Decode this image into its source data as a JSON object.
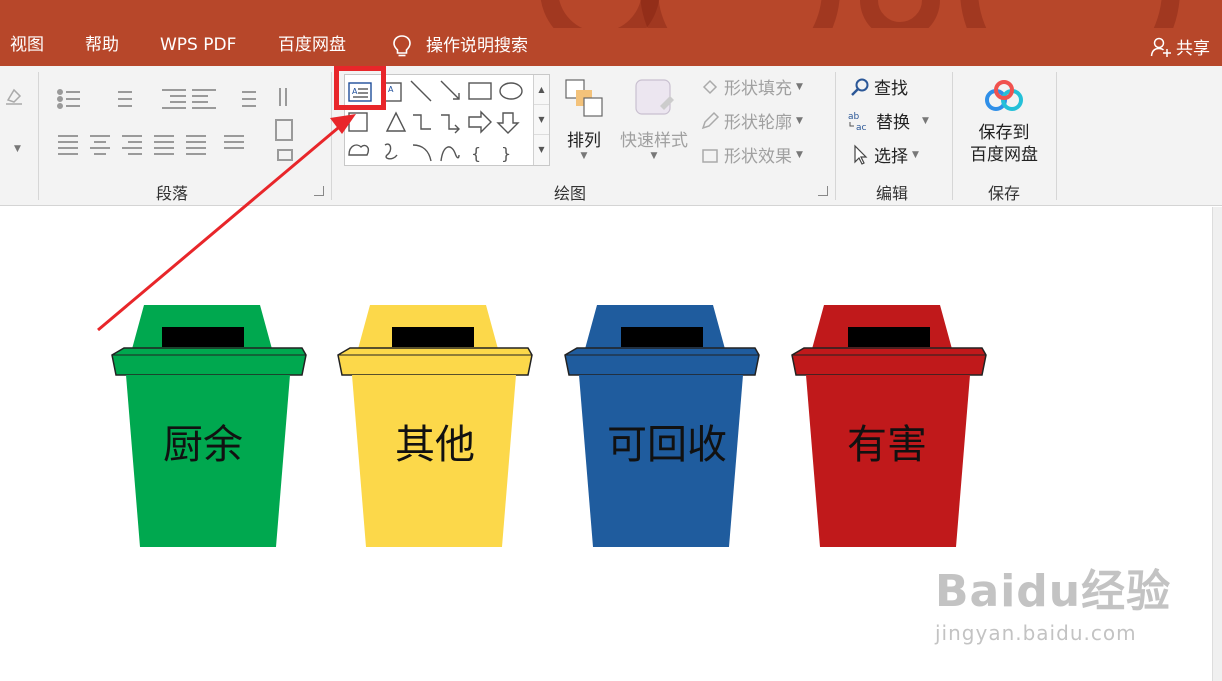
{
  "menubar": {
    "tabs": [
      "视图",
      "帮助",
      "WPS PDF",
      "百度网盘",
      "操作说明搜索"
    ],
    "share_label": "共享"
  },
  "ribbon": {
    "groups": {
      "paragraph": "段落",
      "drawing": "绘图",
      "editing": "编辑",
      "save": "保存"
    },
    "drawing": {
      "arrange_label": "排列",
      "quick_styles_label": "快速样式",
      "shape_fill_label": "形状填充",
      "shape_outline_label": "形状轮廓",
      "shape_effects_label": "形状效果"
    },
    "editing": {
      "find_label": "查找",
      "replace_label": "替换",
      "select_label": "选择"
    },
    "save": {
      "save_to_line1": "保存到",
      "save_to_line2": "百度网盘"
    }
  },
  "slide": {
    "bins": [
      {
        "label": "厨余",
        "color": "#00a84f"
      },
      {
        "label": "其他",
        "color": "#fcd84a"
      },
      {
        "label": "可回收",
        "color": "#1f5c9e"
      },
      {
        "label": "有害",
        "color": "#c0191b"
      }
    ]
  },
  "watermark": {
    "main": "Baidu经验",
    "url": "jingyan.baidu.com"
  },
  "colors": {
    "accent": "#b7472a",
    "highlight": "#e8262a"
  },
  "icons": [
    "lightbulb-icon",
    "share-person-icon",
    "text-box-icon",
    "search-icon",
    "replace-icon",
    "select-cursor-icon",
    "baidu-cloud-icon"
  ]
}
